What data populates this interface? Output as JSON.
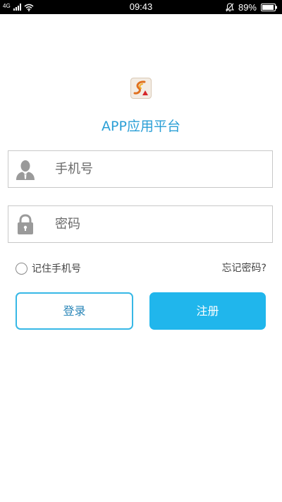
{
  "status_bar": {
    "network": "4G",
    "time": "09:43",
    "battery": "89%",
    "icons": [
      "signal-icon",
      "wifi-icon",
      "mute-icon",
      "battery-icon"
    ]
  },
  "app": {
    "title": "APP应用平台",
    "logo": "app-logo"
  },
  "form": {
    "phone_placeholder": "手机号",
    "password_placeholder": "密码",
    "remember_label": "记住手机号",
    "forgot_label": "忘记密码?"
  },
  "buttons": {
    "login": "登录",
    "register": "注册"
  },
  "colors": {
    "accent": "#20b6ec",
    "title": "#2a9fd6",
    "border": "#c8c8c8"
  }
}
